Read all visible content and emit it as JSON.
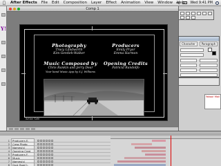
{
  "menubar": {
    "app": "After Effects",
    "items": [
      "File",
      "Edit",
      "Composition",
      "Layer",
      "Effect",
      "Animation",
      "View",
      "Window",
      "Help"
    ],
    "clock": "Wed 9:41 PM"
  },
  "window": {
    "title": "Comp 1"
  },
  "browser": {
    "logo": "Y!"
  },
  "comp": {
    "credit1_title": "Photography",
    "credit1_names": [
      "Tracy Landworth",
      "Kim Gentleh-Walker"
    ],
    "credit2_title": "Producers",
    "credit2_names": [
      "Emily Pryor",
      "Emma Harmon"
    ],
    "credit3_title": "Music Composed by",
    "credit3_names": [
      "Chris Rankin and Jerry Dear",
      "Your band Music App by S.J. Williams"
    ],
    "credit4_title": "Opening Credits",
    "credit4_names": [
      "Patricia Randolfo"
    ],
    "photo_caption": "Dust Bowl",
    "corner_label": "Action Safe"
  },
  "panels": {
    "character_tab": "Character",
    "paragraph_tab": "Paragraph",
    "colors": {
      "fill": "#ffffff",
      "stroke": "#000000"
    },
    "web": {
      "header": "Yahoo! Mail"
    }
  },
  "timeline": {
    "layers": [
      {
        "num": "1",
        "name": "Producers E."
      },
      {
        "num": "2",
        "name": "Crew Photo"
      },
      {
        "num": "3",
        "name": "Names(s)"
      },
      {
        "num": "4",
        "name": "Opening Cred"
      },
      {
        "num": "5",
        "name": "Producers F."
      },
      {
        "num": "6",
        "name": "Music"
      },
      {
        "num": "7",
        "name": "Names(s)"
      },
      {
        "num": "8",
        "name": "Dust Bowl t."
      },
      {
        "num": "9",
        "name": "Solid 1"
      }
    ],
    "bar_colors": [
      "#d89aa6",
      "#d6a4a8",
      "#c48c96",
      "#d0a0a0",
      "#c98f9c",
      "#cba1a6",
      "#c88e97",
      "#9aa8c4",
      "#c7c7c7"
    ]
  }
}
